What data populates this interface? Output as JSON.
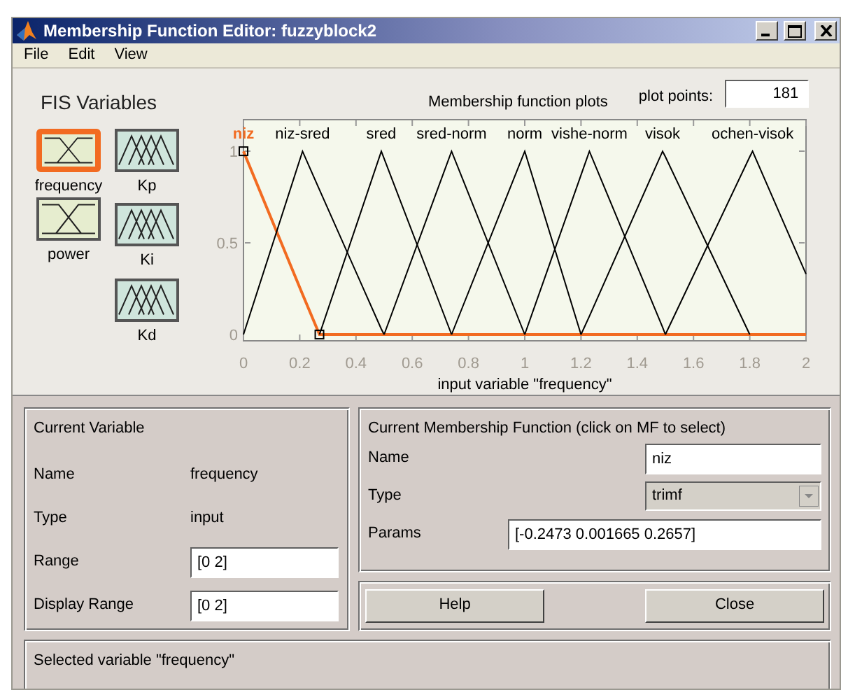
{
  "window": {
    "title": "Membership Function Editor: fuzzyblock2"
  },
  "menu": [
    {
      "label": "File"
    },
    {
      "label": "Edit"
    },
    {
      "label": "View"
    }
  ],
  "fis_variables": {
    "title": "FIS Variables",
    "inputs": [
      {
        "name": "frequency",
        "selected": true
      },
      {
        "name": "power",
        "selected": false
      }
    ],
    "outputs": [
      {
        "name": "Kp",
        "selected": false
      },
      {
        "name": "Ki",
        "selected": false
      },
      {
        "name": "Kd",
        "selected": false
      }
    ]
  },
  "plot": {
    "plot_points_label": "plot points:",
    "plot_points": "181",
    "chart_data": {
      "type": "line",
      "title": "Membership function plots",
      "xlabel": "input variable \"frequency\"",
      "x": [
        0,
        0.21,
        0.27,
        0.49,
        0.5,
        0.74,
        1,
        1.2,
        1.23,
        1.49,
        1.5,
        1.8,
        1.81,
        2
      ],
      "series": [
        {
          "name": "niz",
          "color": "#f26b21",
          "values": [
            1,
            0.22,
            0,
            0,
            0,
            0,
            0,
            0,
            0,
            0,
            0,
            0,
            0,
            0
          ]
        },
        {
          "name": "niz-sred",
          "color": "#000000",
          "values": [
            0,
            1,
            0.79,
            0.03,
            0,
            null,
            null,
            null,
            null,
            null,
            null,
            null,
            null,
            null
          ]
        },
        {
          "name": "sred",
          "color": "#000000",
          "values": [
            null,
            null,
            0,
            1,
            0.96,
            0,
            null,
            null,
            null,
            null,
            null,
            null,
            null,
            null
          ]
        },
        {
          "name": "sred-norm",
          "color": "#000000",
          "values": [
            null,
            null,
            null,
            null,
            0,
            1,
            0,
            null,
            null,
            null,
            null,
            null,
            null,
            null
          ]
        },
        {
          "name": "norm",
          "color": "#000000",
          "values": [
            null,
            null,
            null,
            null,
            null,
            0,
            1,
            0,
            null,
            null,
            null,
            null,
            null,
            null
          ]
        },
        {
          "name": "vishe-norm",
          "color": "#000000",
          "values": [
            null,
            null,
            null,
            null,
            null,
            null,
            0,
            0.87,
            1,
            0.04,
            0,
            null,
            null,
            null
          ]
        },
        {
          "name": "visok",
          "color": "#000000",
          "values": [
            null,
            null,
            null,
            null,
            null,
            null,
            null,
            0,
            0.1,
            1,
            0.97,
            0,
            null,
            null
          ]
        },
        {
          "name": "ochen-visok",
          "color": "#000000",
          "values": [
            null,
            null,
            null,
            null,
            null,
            null,
            null,
            null,
            null,
            null,
            0,
            0.97,
            1,
            0.33
          ]
        }
      ],
      "xlim": [
        0,
        2
      ],
      "ylim": [
        -0.038,
        1.176
      ],
      "xticks": [
        0,
        0.2,
        0.4,
        0.6,
        0.8,
        1,
        1.2,
        1.4,
        1.6,
        1.8,
        2
      ],
      "yticks": [
        0,
        0.5,
        1
      ]
    }
  },
  "current_variable": {
    "title": "Current Variable",
    "fields": [
      {
        "kind": "text",
        "label": "Name",
        "value": "frequency"
      },
      {
        "kind": "text",
        "label": "Type",
        "value": "input"
      },
      {
        "kind": "input",
        "label": "Range",
        "value": "[0 2]"
      },
      {
        "kind": "input",
        "label": "Display Range",
        "value": "[0 2]"
      }
    ]
  },
  "current_mf": {
    "title": "Current Membership Function (click on MF to select)",
    "fields": [
      {
        "kind": "input",
        "label": "Name",
        "value": "niz"
      },
      {
        "kind": "select",
        "label": "Type",
        "value": "trimf"
      },
      {
        "kind": "wide",
        "label": "Params",
        "value": "[-0.2473 0.001665 0.2657]"
      }
    ]
  },
  "buttons": [
    {
      "label": "Help"
    },
    {
      "label": "Close"
    }
  ],
  "status": "Selected variable \"frequency\""
}
